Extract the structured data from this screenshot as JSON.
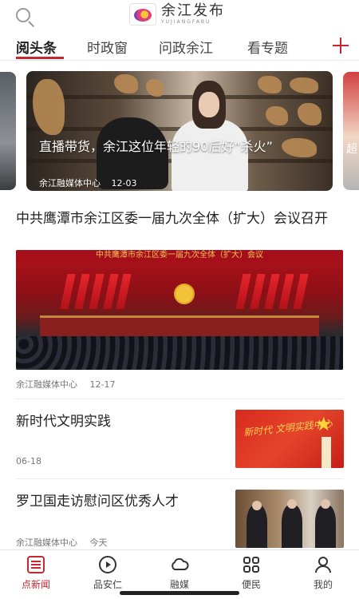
{
  "header": {
    "logo_cn": "余江发布",
    "logo_en": "YUJIANGFABU"
  },
  "tabs": [
    {
      "label": "阅头条",
      "active": true
    },
    {
      "label": "时政窗",
      "active": false
    },
    {
      "label": "问政余江",
      "active": false
    },
    {
      "label": "看专题",
      "active": false
    }
  ],
  "carousel": {
    "title": "直播带货，余江这位年轻的90后好“杀火”",
    "source": "余江融媒体中心",
    "date": "12-03",
    "right_peek_glyph": "超"
  },
  "articles": [
    {
      "title": "中共鹰潭市余江区委一届九次全体（扩大）会议召开",
      "image_banner": "中共鹰潭市余江区委一届九次全体（扩大）会议",
      "source": "余江融媒体中心",
      "date": "12-17"
    },
    {
      "title": "新时代文明实践",
      "date": "06-18",
      "image_caption": "新时代 文明实践中心"
    },
    {
      "title": "罗卫国走访慰问区优秀人才",
      "source": "余江融媒体中心",
      "date": "今天"
    }
  ],
  "bottom_nav": [
    {
      "label": "点新闻",
      "icon": "news-list-icon",
      "active": true
    },
    {
      "label": "品安仁",
      "icon": "play-circle-icon",
      "active": false
    },
    {
      "label": "融媒",
      "icon": "cloud-icon",
      "active": false
    },
    {
      "label": "便民",
      "icon": "grid-icon",
      "active": false
    },
    {
      "label": "我的",
      "icon": "person-icon",
      "active": false
    }
  ],
  "colors": {
    "accent": "#c9262f",
    "text": "#222222",
    "meta": "#777777"
  }
}
